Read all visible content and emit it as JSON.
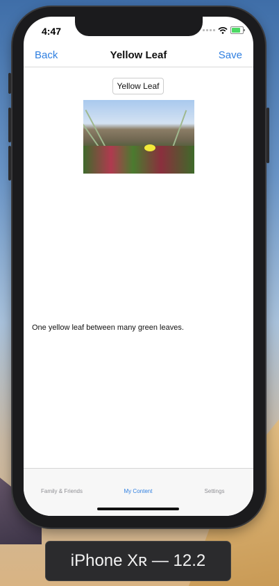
{
  "status_bar": {
    "time": "4:47"
  },
  "nav": {
    "back_label": "Back",
    "title": "Yellow Leaf",
    "save_label": "Save"
  },
  "content": {
    "title_field_value": "Yellow Leaf",
    "description": "One yellow leaf between many green leaves."
  },
  "tabs": [
    {
      "label": "Family & Friends"
    },
    {
      "label": "My Content"
    },
    {
      "label": "Settings"
    }
  ],
  "simulator_label": "iPhone Xʀ — 12.2",
  "colors": {
    "accent": "#2f7fe0",
    "battery": "#4cd964"
  }
}
